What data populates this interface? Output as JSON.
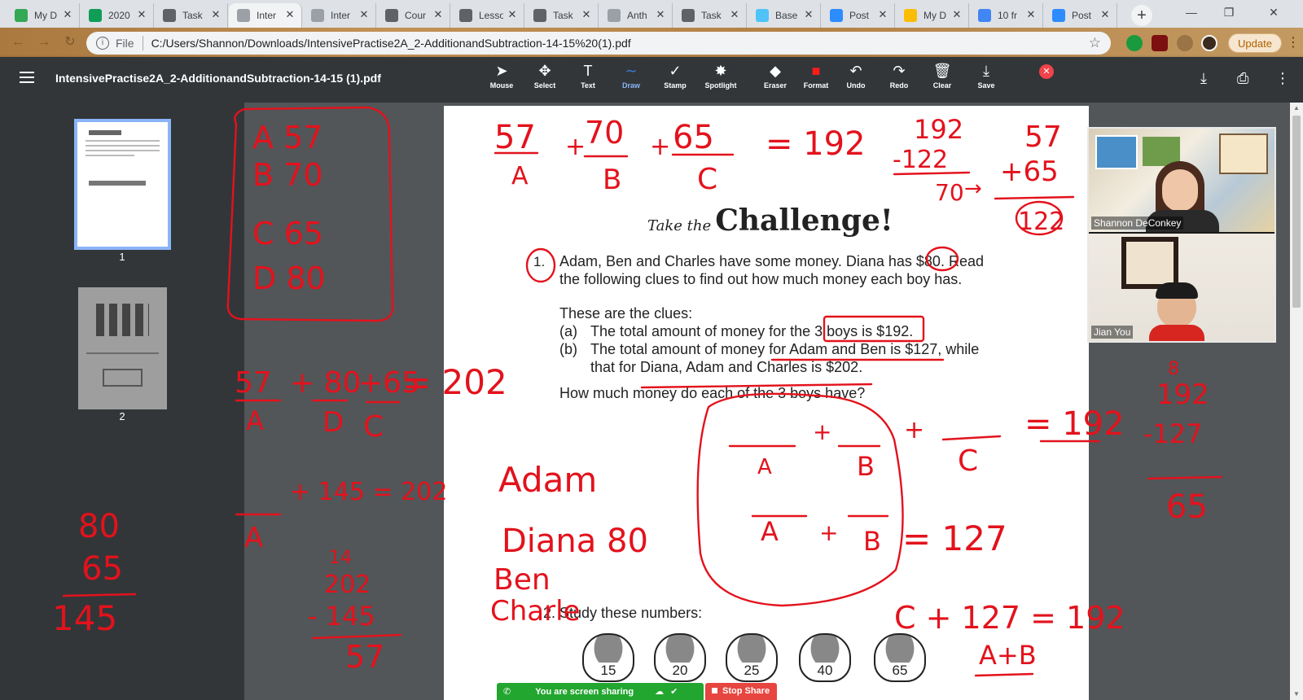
{
  "browser": {
    "tabs": [
      {
        "label": "My D",
        "color": "#34a853"
      },
      {
        "label": "2020",
        "color": "#0f9d58"
      },
      {
        "label": "Task",
        "color": "#5f6368"
      },
      {
        "label": "Inter",
        "color": "#9aa0a6",
        "active": true
      },
      {
        "label": "Inter",
        "color": "#9aa0a6"
      },
      {
        "label": "Cour",
        "color": "#5f6368"
      },
      {
        "label": "Lesso",
        "color": "#5f6368"
      },
      {
        "label": "Task",
        "color": "#5f6368"
      },
      {
        "label": "Anth",
        "color": "#9aa0a6"
      },
      {
        "label": "Task",
        "color": "#5f6368"
      },
      {
        "label": "Base",
        "color": "#4fc3f7"
      },
      {
        "label": "Post",
        "color": "#2d8cff"
      },
      {
        "label": "My D",
        "color": "#fbbc04"
      },
      {
        "label": "10 fr",
        "color": "#4285f4"
      },
      {
        "label": "Post",
        "color": "#2d8cff"
      }
    ],
    "new_tab": "+",
    "address": {
      "scheme": "File",
      "url": "C:/Users/Shannon/Downloads/IntensivePractise2A_2-AdditionandSubtraction-14-15%20(1).pdf"
    },
    "update_label": "Update",
    "window": {
      "minimize": "—",
      "restore": "❐",
      "close": "✕"
    }
  },
  "pdf": {
    "title": "IntensivePractise2A_2-AdditionandSubtraction-14-15 (1).pdf",
    "tools": [
      {
        "name": "mouse",
        "label": "Mouse",
        "icon": "➤"
      },
      {
        "name": "select",
        "label": "Select",
        "icon": "✥"
      },
      {
        "name": "text",
        "label": "Text",
        "icon": "T"
      },
      {
        "name": "draw",
        "label": "Draw",
        "icon": "∼",
        "active": true
      },
      {
        "name": "stamp",
        "label": "Stamp",
        "icon": "✓"
      },
      {
        "name": "spotlight",
        "label": "Spotlight",
        "icon": "✸"
      },
      {
        "name": "eraser",
        "label": "Eraser",
        "icon": "◆"
      },
      {
        "name": "format",
        "label": "Format",
        "icon": "■"
      },
      {
        "name": "undo",
        "label": "Undo",
        "icon": "↶"
      },
      {
        "name": "redo",
        "label": "Redo",
        "icon": "↷"
      },
      {
        "name": "clear",
        "label": "Clear",
        "icon": "🗑"
      },
      {
        "name": "save",
        "label": "Save",
        "icon": "⤓"
      }
    ],
    "draw_color": "#3a7bd5",
    "format_color": "#ff1a1a",
    "thumbnails": [
      {
        "page": "1"
      },
      {
        "page": "2"
      }
    ],
    "page": {
      "title_small": "Take the",
      "title_big": "Challenge!",
      "q1_number": "1.",
      "q1_text_line1": "Adam, Ben and Charles have some money. Diana has $80. Read",
      "q1_text_line2": "the following clues to find out how much money each boy has.",
      "clues_heading": "These are the clues:",
      "clue_a_label": "(a)",
      "clue_a_text": "The total amount of money for the 3 boys is $192.",
      "clue_b_label": "(b)",
      "clue_b_text_line1": "The total amount of money for Adam and Ben is $127, while",
      "clue_b_text_line2": "that for Diana, Adam and Charles is $202.",
      "question": "How much money do each of the 3 boys have?",
      "q2": "2.  Study these numbers:",
      "basket_numbers": [
        "15",
        "20",
        "25",
        "40",
        "65"
      ]
    }
  },
  "video": {
    "participants": [
      {
        "name": "Shannon DeConkey"
      },
      {
        "name": "Jian You"
      }
    ]
  },
  "screen_share": {
    "status": "You are screen sharing",
    "stop_label": "Stop Share"
  },
  "annotations": {
    "box_list": [
      "A 57",
      "B 70",
      "C 65",
      "D 80"
    ],
    "eq_top": [
      "57",
      "70",
      "65",
      "= 192",
      "A",
      "B",
      "C",
      "+",
      "+"
    ],
    "sub_top": [
      "192",
      "-122",
      "70",
      "→"
    ],
    "add_top": [
      "57",
      "+65",
      "122"
    ],
    "left_eq": [
      "57",
      "+ 80",
      "+65",
      "= 202",
      "A",
      "D",
      "C"
    ],
    "left_sum": [
      "+ 145 = 202",
      "A"
    ],
    "vertical_add": [
      "80",
      "65",
      "145"
    ],
    "vertical_sub": [
      "14",
      "202",
      "- 145",
      "57"
    ],
    "names": [
      "Adam",
      "Diana 80",
      "Ben",
      "Charle"
    ],
    "middle_eq": [
      "+",
      "A",
      "B",
      "A",
      "+",
      "B",
      "= 127",
      "+",
      "C",
      "= 192"
    ],
    "bottom_eq": [
      "C + 127 = 192",
      "A+B"
    ],
    "right_sub": [
      "8",
      "192",
      "-127",
      "65"
    ]
  }
}
